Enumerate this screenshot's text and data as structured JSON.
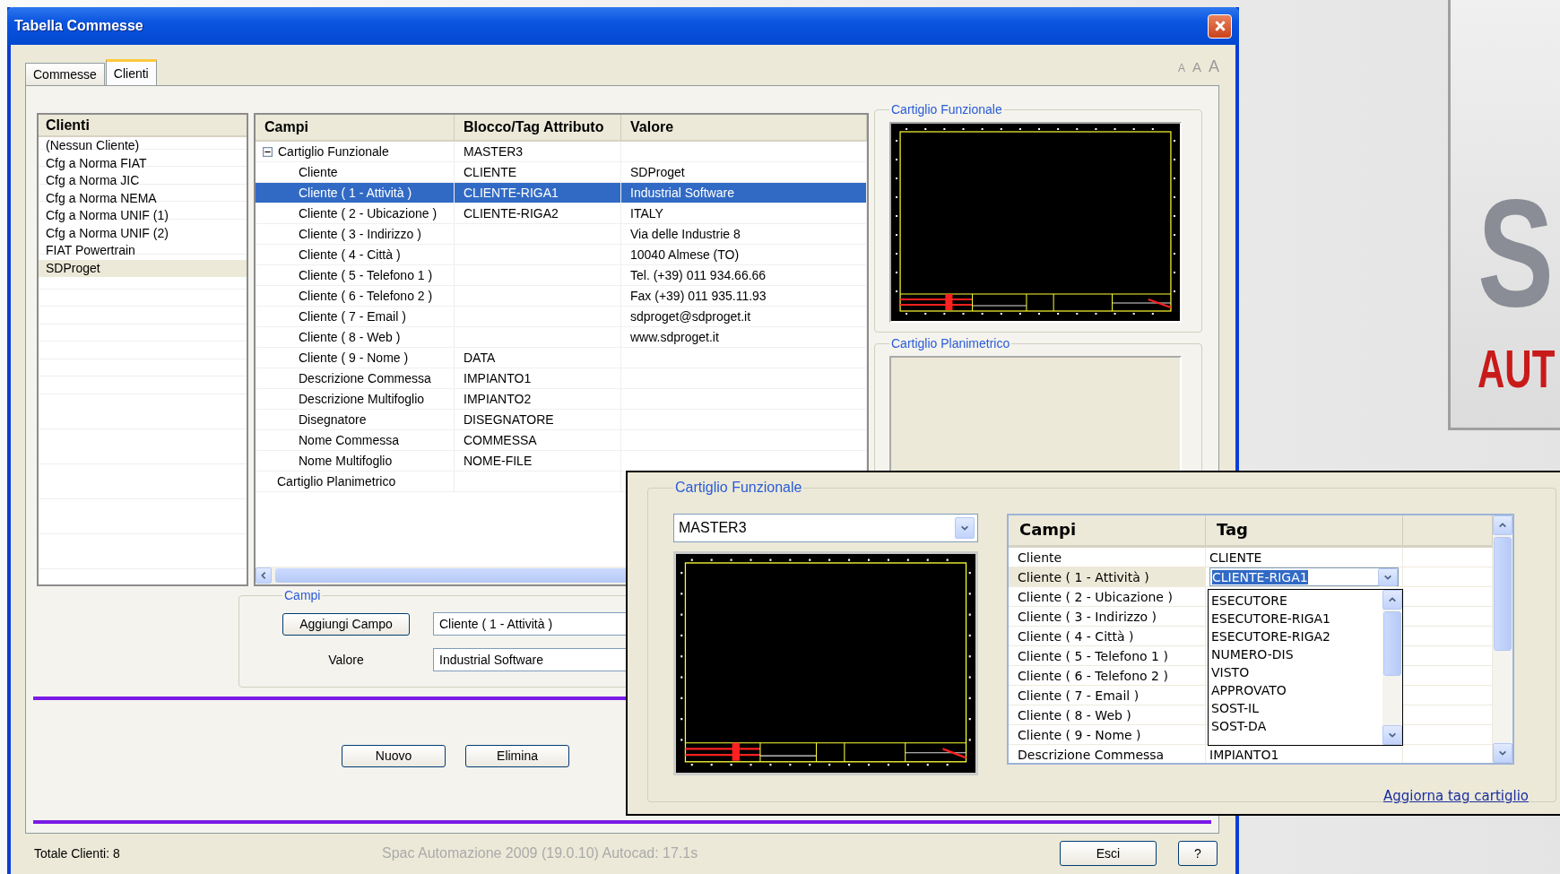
{
  "window": {
    "title": "Tabella Commesse"
  },
  "tabs": [
    {
      "label": "Commesse",
      "selected": false
    },
    {
      "label": "Clienti",
      "selected": true
    }
  ],
  "font_size_buttons": [
    "A",
    "A",
    "A"
  ],
  "clienti": {
    "title": "Clienti",
    "items": [
      {
        "label": "(Nessun Cliente)",
        "selected": false
      },
      {
        "label": "Cfg a Norma FIAT",
        "selected": false
      },
      {
        "label": "Cfg a Norma JIC",
        "selected": false
      },
      {
        "label": "Cfg a Norma NEMA",
        "selected": false
      },
      {
        "label": "Cfg a Norma UNIF (1)",
        "selected": false
      },
      {
        "label": "Cfg a Norma UNIF (2)",
        "selected": false
      },
      {
        "label": "FIAT Powertrain",
        "selected": false
      },
      {
        "label": "SDProget",
        "selected": true
      }
    ]
  },
  "tree": {
    "columns": [
      "Campi",
      "Blocco/Tag Attributo",
      "Valore"
    ],
    "rows": [
      {
        "campo": "Cartiglio Funzionale",
        "tag": "MASTER3",
        "selected": false,
        "expanded": true,
        "children": [
          {
            "campo": "Cliente",
            "tag": "CLIENTE",
            "valore": "SDProget",
            "selected": false
          },
          {
            "campo": "Cliente ( 1 - Attività )",
            "tag": "CLIENTE-RIGA1",
            "valore": "Industrial Software",
            "selected": true
          },
          {
            "campo": "Cliente ( 2 - Ubicazione )",
            "tag": "CLIENTE-RIGA2",
            "valore": "ITALY",
            "selected": false
          },
          {
            "campo": "Cliente ( 3 - Indirizzo )",
            "valore": "Via delle Industrie 8",
            "selected": false
          },
          {
            "campo": "Cliente ( 4 - Città )",
            "valore": "10040 Almese (TO)",
            "selected": false
          },
          {
            "campo": "Cliente ( 5 - Telefono 1 )",
            "valore": "Tel. (+39) 011 934.66.66",
            "selected": false
          },
          {
            "campo": "Cliente ( 6 - Telefono 2 )",
            "valore": "Fax (+39) 011 935.11.93",
            "selected": false
          },
          {
            "campo": "Cliente ( 7 - Email )",
            "valore": "sdproget@sdproget.it",
            "selected": false
          },
          {
            "campo": "Cliente ( 8 - Web )",
            "valore": "www.sdproget.it",
            "selected": false
          },
          {
            "campo": "Cliente ( 9 - Nome )",
            "tag": "DATA",
            "selected": false
          },
          {
            "campo": "Descrizione Commessa",
            "tag": "IMPIANTO1",
            "selected": false
          },
          {
            "campo": "Descrizione Multifoglio",
            "tag": "IMPIANTO2",
            "selected": false
          },
          {
            "campo": "Disegnatore",
            "tag": "DISEGNATORE",
            "selected": false
          },
          {
            "campo": "Nome Commessa",
            "tag": "COMMESSA",
            "selected": false
          },
          {
            "campo": "Nome Multifoglio",
            "tag": "NOME-FILE",
            "selected": false
          }
        ]
      },
      {
        "campo": "Cartiglio Planimetrico",
        "selected": false
      }
    ]
  },
  "preview_groups": [
    {
      "title": "Cartiglio Funzionale",
      "has_drawing": true
    },
    {
      "title": "Cartiglio Planimetrico",
      "has_drawing": false
    }
  ],
  "campi_group": {
    "title": "Campi",
    "add_button": "Aggiungi Campo",
    "field_value": "Cliente ( 1 - Attività )",
    "valore_label": "Valore",
    "valore_value": "Industrial Software"
  },
  "actions": [
    "Nuovo",
    "Elimina"
  ],
  "status": {
    "total": "Totale Clienti: 8",
    "version": "Spac Automazione 2009  (19.0.10)  Autocad: 17.1s",
    "buttons": [
      "Esci",
      "?"
    ]
  },
  "logo": {
    "line1": "S",
    "line2": "AUT"
  },
  "overlay": {
    "group_title": "Cartiglio Funzionale",
    "block": "MASTER3",
    "columns": [
      "Campi",
      "Tag"
    ],
    "rows": [
      {
        "campo": "Cliente",
        "tag": "CLIENTE",
        "selected": false,
        "editing": false
      },
      {
        "campo": "Cliente ( 1 - Attività )",
        "tag": "CLIENTE-RIGA1",
        "selected": true,
        "editing": true
      },
      {
        "campo": "Cliente ( 2 - Ubicazione )",
        "selected": false,
        "editing": false
      },
      {
        "campo": "Cliente ( 3 - Indirizzo )",
        "selected": false,
        "editing": false
      },
      {
        "campo": "Cliente ( 4 - Città )",
        "selected": false,
        "editing": false
      },
      {
        "campo": "Cliente ( 5 - Telefono 1 )",
        "selected": false,
        "editing": false
      },
      {
        "campo": "Cliente ( 6 - Telefono 2 )",
        "selected": false,
        "editing": false
      },
      {
        "campo": "Cliente ( 7 - Email )",
        "selected": false,
        "editing": false
      },
      {
        "campo": "Cliente ( 8 - Web )",
        "selected": false,
        "editing": false
      },
      {
        "campo": "Cliente ( 9 - Nome )",
        "selected": false,
        "editing": false
      },
      {
        "campo": "Descrizione Commessa",
        "tag": "IMPIANTO1",
        "selected": false,
        "editing": false
      }
    ],
    "dropdown_options": [
      "ESECUTORE",
      "ESECUTORE-RIGA1",
      "ESECUTORE-RIGA2",
      "NUMERO-DIS",
      "VISTO",
      "APPROVATO",
      "SOST-IL",
      "SOST-DA"
    ],
    "link": "Aggiorna tag cartiglio"
  }
}
